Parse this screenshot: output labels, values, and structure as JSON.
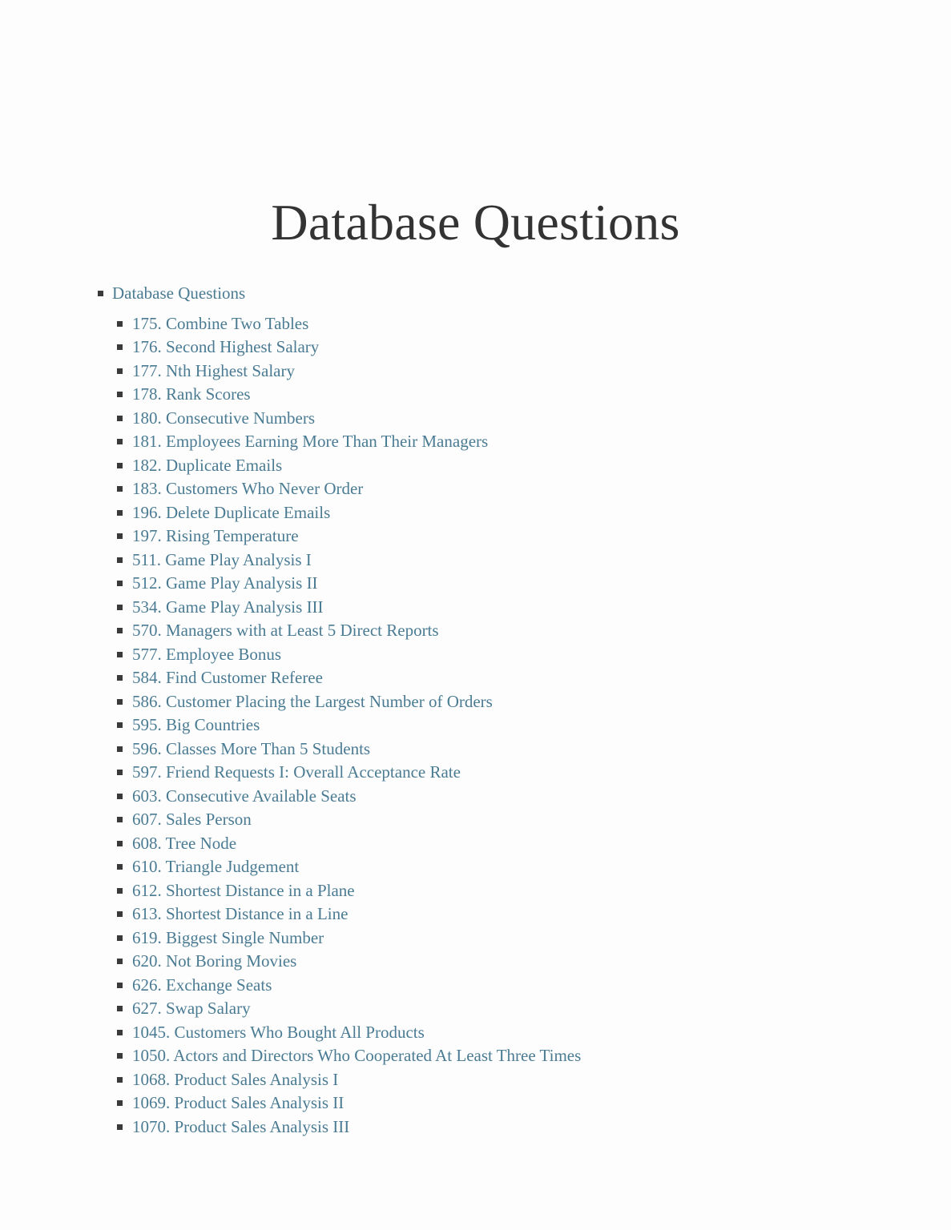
{
  "document": {
    "title": "Database Questions",
    "title_color": "#333333",
    "link_color": "#4a7b93",
    "background_color": "#fdfdfd",
    "bullet_color": "#3a3a3a"
  },
  "toc": {
    "root_label": "Database Questions",
    "items": [
      {
        "label": "175. Combine Two Tables"
      },
      {
        "label": "176. Second Highest Salary"
      },
      {
        "label": "177. Nth Highest Salary"
      },
      {
        "label": "178. Rank Scores"
      },
      {
        "label": "180. Consecutive Numbers"
      },
      {
        "label": "181. Employees Earning More Than Their Managers"
      },
      {
        "label": "182. Duplicate Emails"
      },
      {
        "label": "183. Customers Who Never Order"
      },
      {
        "label": "196. Delete Duplicate Emails"
      },
      {
        "label": "197. Rising Temperature"
      },
      {
        "label": "511. Game Play Analysis I"
      },
      {
        "label": "512. Game Play Analysis II"
      },
      {
        "label": "534. Game Play Analysis III"
      },
      {
        "label": "570. Managers with at Least 5 Direct Reports"
      },
      {
        "label": "577. Employee Bonus"
      },
      {
        "label": "584. Find Customer Referee"
      },
      {
        "label": "586. Customer Placing the Largest Number of Orders"
      },
      {
        "label": "595. Big Countries"
      },
      {
        "label": "596. Classes More Than 5 Students"
      },
      {
        "label": "597. Friend Requests I: Overall Acceptance Rate"
      },
      {
        "label": "603. Consecutive Available Seats"
      },
      {
        "label": "607. Sales Person"
      },
      {
        "label": "608. Tree Node"
      },
      {
        "label": "610. Triangle Judgement"
      },
      {
        "label": "612. Shortest Distance in a Plane"
      },
      {
        "label": "613. Shortest Distance in a Line"
      },
      {
        "label": "619. Biggest Single Number"
      },
      {
        "label": "620. Not Boring Movies"
      },
      {
        "label": "626. Exchange Seats"
      },
      {
        "label": "627. Swap Salary"
      },
      {
        "label": "1045. Customers Who Bought All Products"
      },
      {
        "label": "1050. Actors and Directors Who Cooperated At Least Three Times"
      },
      {
        "label": "1068. Product Sales Analysis I"
      },
      {
        "label": "1069. Product Sales Analysis II"
      },
      {
        "label": "1070. Product Sales Analysis III"
      }
    ]
  }
}
